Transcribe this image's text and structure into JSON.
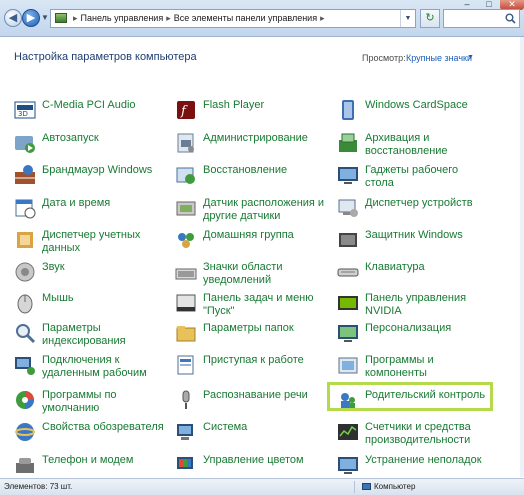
{
  "window": {
    "minimize": "–",
    "maximize": "□",
    "close": "✕"
  },
  "nav": {
    "back_icon": "left-arrow-icon",
    "forward_icon": "right-arrow-icon",
    "breadcrumb": [
      "Панель управления",
      "Все элементы панели управления"
    ],
    "refresh_icon": "refresh-icon",
    "search_placeholder": ""
  },
  "header": {
    "title": "Настройка параметров компьютера",
    "view_by_label": "Просмотр:",
    "view_by_value": "Крупные значки"
  },
  "items": [
    {
      "label": "C-Media PCI Audio",
      "icon": "audio-icon"
    },
    {
      "label": "Flash Player",
      "icon": "flash-icon"
    },
    {
      "label": "Windows CardSpace",
      "icon": "cardspace-icon"
    },
    {
      "label": "Автозапуск",
      "icon": "autoplay-icon"
    },
    {
      "label": "Администрирование",
      "icon": "admin-tools-icon"
    },
    {
      "label": "Архивация и\nвосстановление",
      "icon": "backup-icon"
    },
    {
      "label": "Брандмауэр Windows",
      "icon": "firewall-icon"
    },
    {
      "label": "Восстановление",
      "icon": "recovery-icon"
    },
    {
      "label": "Гаджеты рабочего стола",
      "icon": "gadgets-icon"
    },
    {
      "label": "Дата и время",
      "icon": "datetime-icon"
    },
    {
      "label": "Датчик расположения и\nдругие датчики",
      "icon": "sensor-icon"
    },
    {
      "label": "Диспетчер устройств",
      "icon": "device-manager-icon"
    },
    {
      "label": "Диспетчер учетных\nданных",
      "icon": "credential-manager-icon"
    },
    {
      "label": "Домашняя группа",
      "icon": "homegroup-icon"
    },
    {
      "label": "Защитник Windows",
      "icon": "defender-icon"
    },
    {
      "label": "Звук",
      "icon": "sound-icon"
    },
    {
      "label": "Значки области\nуведомлений",
      "icon": "notification-icons-icon"
    },
    {
      "label": "Клавиатура",
      "icon": "keyboard-icon"
    },
    {
      "label": "Мышь",
      "icon": "mouse-icon"
    },
    {
      "label": "Панель задач и меню\n\"Пуск\"",
      "icon": "taskbar-icon"
    },
    {
      "label": "Панель управления\nNVIDIA",
      "icon": "nvidia-icon"
    },
    {
      "label": "Параметры\nиндексирования",
      "icon": "indexing-icon"
    },
    {
      "label": "Параметры папок",
      "icon": "folder-options-icon"
    },
    {
      "label": "Персонализация",
      "icon": "personalization-icon"
    },
    {
      "label": "Подключения к\nудаленным рабочим",
      "icon": "remote-desktop-icon"
    },
    {
      "label": "Приступая к работе",
      "icon": "getting-started-icon"
    },
    {
      "label": "Программы и\nкомпоненты",
      "icon": "programs-icon"
    },
    {
      "label": "Программы по\nумолчанию",
      "icon": "default-programs-icon"
    },
    {
      "label": "Распознавание речи",
      "icon": "speech-icon"
    },
    {
      "label": "Родительский контроль",
      "icon": "parental-controls-icon"
    },
    {
      "label": "Свойства обозревателя",
      "icon": "internet-options-icon"
    },
    {
      "label": "Система",
      "icon": "system-icon"
    },
    {
      "label": "Счетчики и средства\nпроизводительности",
      "icon": "performance-icon"
    },
    {
      "label": "Телефон и модем",
      "icon": "phone-modem-icon"
    },
    {
      "label": "Управление цветом",
      "icon": "color-management-icon"
    },
    {
      "label": "Устранение неполадок",
      "icon": "troubleshooting-icon"
    }
  ],
  "status": {
    "items_count": "Элементов: 73 шт.",
    "location": "Компьютер"
  },
  "colors": {
    "link_green": "#187a33",
    "heading_blue": "#1f3d72",
    "highlight": "#b4d94b"
  }
}
